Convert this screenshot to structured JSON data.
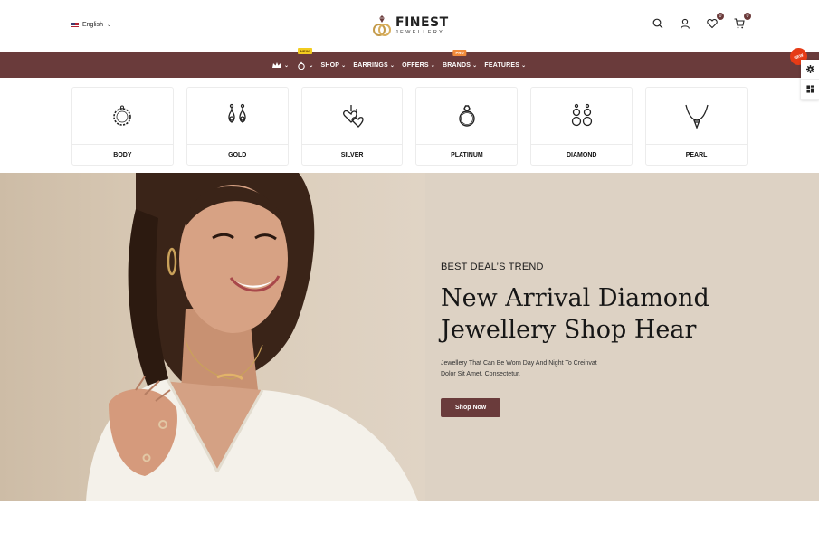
{
  "header": {
    "language": "English",
    "logo": {
      "title": "FINEST",
      "subtitle": "JEWELLERY"
    },
    "wishlist_count": "0",
    "cart_count": "0"
  },
  "nav": {
    "items": [
      {
        "label": "",
        "icon": "crown-icon",
        "badge": ""
      },
      {
        "label": "",
        "icon": "ring-icon",
        "badge": "NEW"
      },
      {
        "label": "SHOP",
        "badge": ""
      },
      {
        "label": "EARRINGS",
        "badge": ""
      },
      {
        "label": "OFFERS",
        "badge": ""
      },
      {
        "label": "BRANDS",
        "badge": "PRO"
      },
      {
        "label": "FEATURES",
        "badge": ""
      }
    ]
  },
  "side": {
    "new_badge": "NEW"
  },
  "categories": [
    {
      "label": "BODY",
      "icon": "bracelet-icon"
    },
    {
      "label": "GOLD",
      "icon": "drop-earrings-icon"
    },
    {
      "label": "SILVER",
      "icon": "heart-earrings-icon"
    },
    {
      "label": "PLATINUM",
      "icon": "diamond-ring-icon"
    },
    {
      "label": "DIAMOND",
      "icon": "hoop-earrings-icon"
    },
    {
      "label": "PEARL",
      "icon": "pendant-necklace-icon"
    }
  ],
  "hero": {
    "kicker": "BEST DEAL’S TREND",
    "headline_line1": "New Arrival Diamond",
    "headline_line2": "Jewellery Shop Hear",
    "blurb_line1": "Jewellery That Can Be Worn Day And Night To Creinvat",
    "blurb_line2": "Dolor Sit Amet, Consectetur.",
    "cta": "Shop Now"
  },
  "colors": {
    "brand": "#6a3b3b",
    "hero_bg": "#ddd2c4",
    "new_tag": "#f2cc1f",
    "pro_tag": "#f08a3a",
    "new_burst": "#e63b16"
  }
}
